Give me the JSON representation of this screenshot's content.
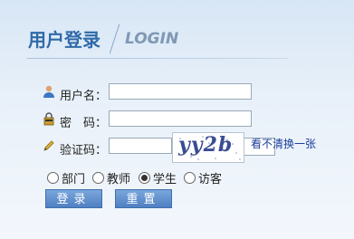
{
  "header": {
    "title_cn": "用户登录",
    "title_en": "LOGIN"
  },
  "form": {
    "username_label": "用户名：",
    "username_value": "",
    "password_label": "密　码：",
    "password_value": "",
    "captcha_label": "验证码：",
    "captcha_value": "",
    "captcha_image_text": "yy2b",
    "refresh_link": "看不清换一张"
  },
  "roles": [
    {
      "label": "部门",
      "selected": false
    },
    {
      "label": "教师",
      "selected": false
    },
    {
      "label": "学生",
      "selected": true
    },
    {
      "label": "访客",
      "selected": false
    }
  ],
  "buttons": {
    "login": "登录",
    "reset": "重置"
  },
  "colors": {
    "title": "#2f6aa8",
    "button": "#4f80c2",
    "link": "#1a3e9a"
  }
}
